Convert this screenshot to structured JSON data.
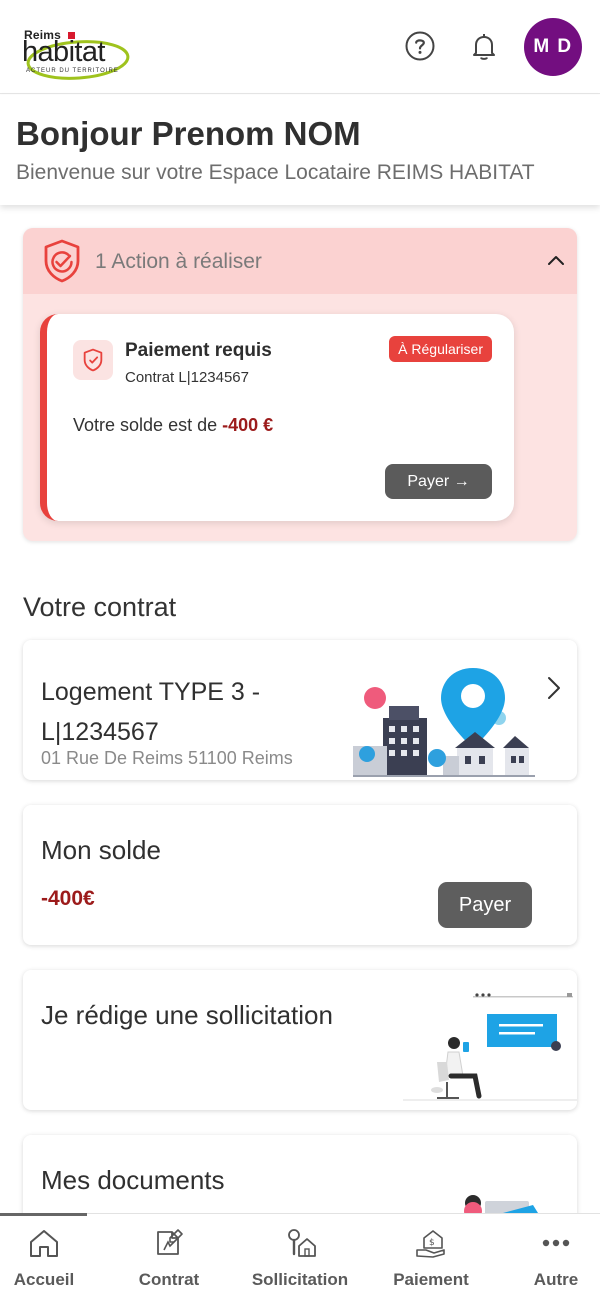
{
  "header": {
    "logo": {
      "line1": "Reims",
      "word": "habitat",
      "tagline": "ACTEUR DU TERRITOIRE"
    },
    "help_icon": "help-circle-icon",
    "bell_icon": "bell-icon",
    "avatar_initials": "M D",
    "avatar_color": "#730e80"
  },
  "greeting": {
    "title": "Bonjour Prenom NOM",
    "subtitle": "Bienvenue sur votre Espace Locataire REIMS HABITAT"
  },
  "actions": {
    "title": "1 Action à réaliser",
    "card": {
      "title": "Paiement requis",
      "contract": "Contrat L|1234567",
      "badge": "À Régulariser",
      "balance_prefix": "Votre solde est de",
      "balance_amount": "-400 €",
      "pay_button": "Payer →"
    },
    "accent": "#e8423d",
    "bg": "#fde3e2"
  },
  "contract_section": {
    "title": "Votre contrat",
    "housing_line1": "Logement TYPE 3 -",
    "housing_line2": "L|1234567",
    "address": "01 Rue De Reims 51100 Reims"
  },
  "balance_card": {
    "title": "Mon solde",
    "amount": "-400€",
    "button": "Payer"
  },
  "request_card": {
    "title": "Je rédige une sollicitation"
  },
  "documents_card": {
    "title": "Mes documents"
  },
  "bottom_nav": {
    "items": [
      {
        "label": "Accueil",
        "icon": "home-icon"
      },
      {
        "label": "Contrat",
        "icon": "contract-icon"
      },
      {
        "label": "Sollicitation",
        "icon": "request-tools-icon"
      },
      {
        "label": "Paiement",
        "icon": "payment-icon"
      },
      {
        "label": "Autre",
        "icon": "more-dots-icon"
      }
    ],
    "active": "Accueil"
  }
}
